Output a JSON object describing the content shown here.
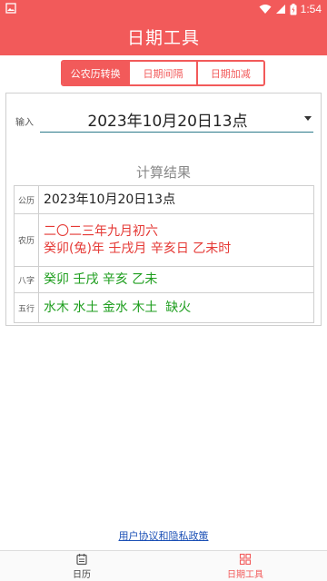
{
  "status_bar": {
    "time": "1:54",
    "icons": [
      "image-icon",
      "wifi-icon",
      "signal-icon",
      "battery-icon"
    ]
  },
  "header": {
    "title": "日期工具"
  },
  "tabs": [
    {
      "label": "公农历转换",
      "active": true
    },
    {
      "label": "日期间隔",
      "active": false
    },
    {
      "label": "日期加减",
      "active": false
    }
  ],
  "input": {
    "label": "输入",
    "value": "2023年10月20日13点"
  },
  "results": {
    "title": "计算结果",
    "rows": [
      {
        "label": "公历",
        "lines": [
          "2023年10月20日13点"
        ],
        "color": "#222222"
      },
      {
        "label": "农历",
        "lines": [
          "二〇二三年九月初六",
          "癸卯(兔)年 壬戌月 辛亥日 乙未时"
        ],
        "color": "#e53935"
      },
      {
        "label": "八字",
        "lines": [
          "癸卯 壬戌 辛亥 乙未"
        ],
        "color": "#1e9e1e"
      },
      {
        "label": "五行",
        "lines": [
          "水木 水土 金水 木土  缺火"
        ],
        "color": "#1e9e1e"
      }
    ]
  },
  "footer": {
    "link": "用户协议和隐私政策"
  },
  "bottom_nav": [
    {
      "label": "日历",
      "icon": "calendar-icon",
      "active": false
    },
    {
      "label": "日期工具",
      "icon": "tools-grid-icon",
      "active": true
    }
  ],
  "colors": {
    "accent": "#f25a5a",
    "link": "#1a4fb5"
  }
}
